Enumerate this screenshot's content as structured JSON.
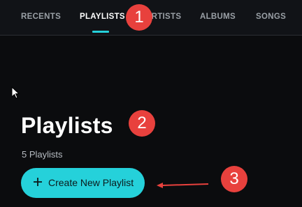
{
  "nav": {
    "tabs": [
      {
        "label": "RECENTS"
      },
      {
        "label": "PLAYLISTS"
      },
      {
        "label": "ARTISTS"
      },
      {
        "label": "ALBUMS"
      },
      {
        "label": "SONGS"
      }
    ],
    "active_tab": "PLAYLISTS"
  },
  "main": {
    "title": "Playlists",
    "count_text": "5 Playlists",
    "create_button_label": "Create New Playlist"
  },
  "annotations": {
    "marker_1": "1",
    "marker_2": "2",
    "marker_3": "3"
  },
  "colors": {
    "accent": "#25d1da",
    "marker": "#e8413d",
    "background": "#0b0c0e"
  },
  "icons": {
    "create_button": "plus-icon",
    "cursor": "mouse-pointer-icon",
    "annotation_arrow": "arrow-left-icon"
  }
}
